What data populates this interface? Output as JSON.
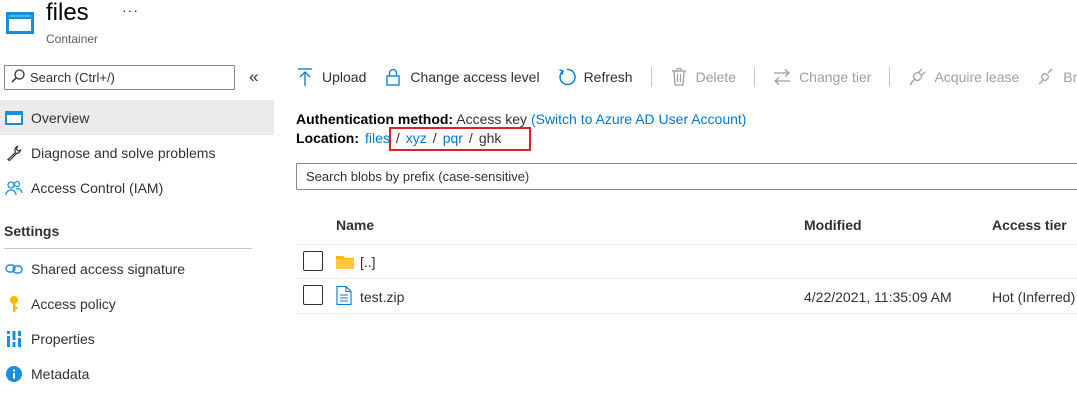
{
  "header": {
    "title": "files",
    "more": "···",
    "subtitle": "Container"
  },
  "sidebar": {
    "search_placeholder": "Search (Ctrl+/)",
    "collapse": "«",
    "items": [
      {
        "label": "Overview",
        "icon": "overview-icon",
        "active": true
      },
      {
        "label": "Diagnose and solve problems",
        "icon": "wrench-icon"
      },
      {
        "label": "Access Control (IAM)",
        "icon": "people-icon"
      }
    ],
    "section": "Settings",
    "settings_items": [
      {
        "label": "Shared access signature",
        "icon": "link-icon"
      },
      {
        "label": "Access policy",
        "icon": "key-icon"
      },
      {
        "label": "Properties",
        "icon": "properties-icon"
      },
      {
        "label": "Metadata",
        "icon": "info-icon"
      }
    ]
  },
  "toolbar": {
    "upload": "Upload",
    "change_access": "Change access level",
    "refresh": "Refresh",
    "delete": "Delete",
    "change_tier": "Change tier",
    "acquire_lease": "Acquire lease",
    "break_lease": "Br"
  },
  "info": {
    "auth_label": "Authentication method:",
    "auth_value": "Access key",
    "auth_link": "(Switch to Azure AD User Account)",
    "location_label": "Location:",
    "breadcrumb": [
      "files",
      "xyz",
      "pqr",
      "ghk"
    ],
    "separator": "/"
  },
  "blob_search_placeholder": "Search blobs by prefix (case-sensitive)",
  "table": {
    "headers": {
      "name": "Name",
      "modified": "Modified",
      "tier": "Access tier"
    },
    "rows": [
      {
        "name": "[..]",
        "type": "folder",
        "modified": "",
        "tier": ""
      },
      {
        "name": "test.zip",
        "type": "file",
        "modified": "4/22/2021, 11:35:09 AM",
        "tier": "Hot (Inferred)"
      }
    ]
  },
  "colors": {
    "accent": "#0078d4",
    "highlight_border": "#e01e23",
    "folder": "#ffb900"
  }
}
